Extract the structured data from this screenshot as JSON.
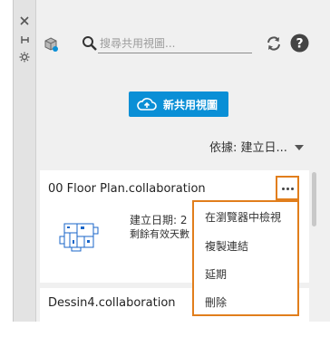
{
  "search": {
    "placeholder": "搜尋共用視圖..."
  },
  "new_button": {
    "label": "新共用視圖"
  },
  "sort": {
    "label": "依據: 建立日..."
  },
  "cards": [
    {
      "title": "00 Floor Plan.collaboration",
      "created_label": "建立日期: 2",
      "remaining_label": "剩餘有效天數"
    },
    {
      "title": "Dessin4.collaboration"
    }
  ],
  "menu": {
    "items": [
      "在瀏覽器中檢視",
      "複製連結",
      "延期",
      "刪除"
    ]
  },
  "colors": {
    "accent": "#0a8fd6",
    "highlight": "#e17e1c"
  },
  "icons": [
    "close-icon",
    "pin-icon",
    "settings-icon",
    "cube-icon",
    "search-icon",
    "refresh-icon",
    "help-icon",
    "cloud-upload-icon",
    "chevron-down-icon",
    "more-icon"
  ]
}
